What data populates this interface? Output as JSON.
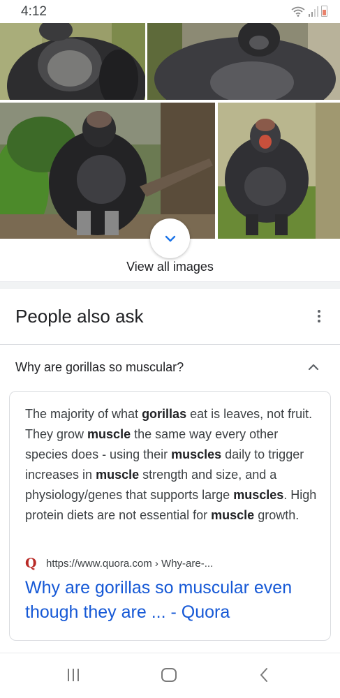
{
  "status_bar": {
    "time": "4:12",
    "icons": [
      "wifi-icon",
      "signal-icon",
      "battery-icon"
    ]
  },
  "image_results": {
    "images": [
      {
        "subject": "gorilla"
      },
      {
        "subject": "gorilla"
      },
      {
        "subject": "gorilla"
      },
      {
        "subject": "gorilla"
      }
    ],
    "expand_icon": "chevron-down-icon",
    "view_all_label": "View all images"
  },
  "people_also_ask": {
    "title": "People also ask",
    "more_icon": "more-vert-icon",
    "question": "Why are gorillas so muscular?",
    "answer_segments": [
      {
        "text": "The majority of what ",
        "bold": false
      },
      {
        "text": "gorillas",
        "bold": true
      },
      {
        "text": " eat is leaves, not fruit. They grow ",
        "bold": false
      },
      {
        "text": "muscle",
        "bold": true
      },
      {
        "text": " the same way every other species does - using their ",
        "bold": false
      },
      {
        "text": "muscles",
        "bold": true
      },
      {
        "text": " daily to trigger increases in ",
        "bold": false
      },
      {
        "text": "muscle",
        "bold": true
      },
      {
        "text": " strength and size, and a physiology/genes that supports large ",
        "bold": false
      },
      {
        "text": "muscles",
        "bold": true
      },
      {
        "text": ". High protein diets are not essential for ",
        "bold": false
      },
      {
        "text": "muscle",
        "bold": true
      },
      {
        "text": " growth.",
        "bold": false
      }
    ],
    "source_icon_letter": "Q",
    "source_url": "https://www.quora.com › Why-are-...",
    "result_title": "Why are gorillas so muscular even though they are ... - Quora"
  },
  "nav_bar": {
    "buttons": [
      "recent-apps-button",
      "home-button",
      "back-button"
    ]
  },
  "colors": {
    "link": "#1558d6",
    "accent_blue": "#1a73e8",
    "quora_red": "#b92b27"
  }
}
